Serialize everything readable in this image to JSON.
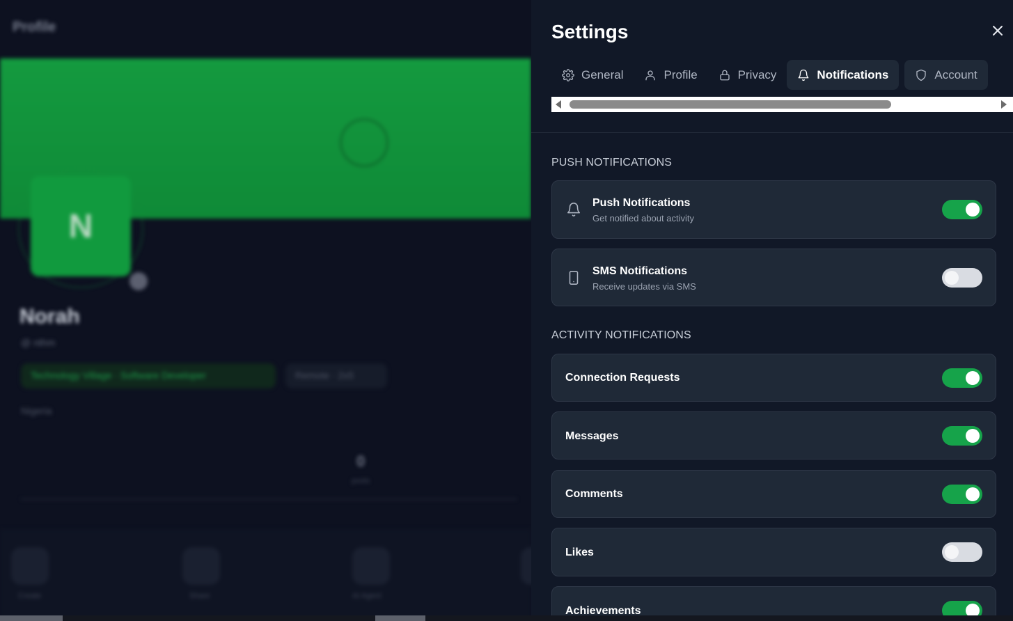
{
  "background": {
    "page_title": "Profile",
    "avatar_initial": "N",
    "name": "Norah",
    "handle": "@ nthm",
    "role_chip": "Technology Village · Software Developer",
    "status_chip": "Remote · 2x5",
    "location": "Nigeria",
    "stat_value": "0",
    "stat_label": "posts",
    "actions": [
      {
        "label": "Create"
      },
      {
        "label": "Share"
      },
      {
        "label": "AI Agent"
      }
    ]
  },
  "settings": {
    "title": "Settings",
    "close_icon": "close-icon",
    "tabs": [
      {
        "label": "General",
        "icon": "gear-icon",
        "active": false
      },
      {
        "label": "Profile",
        "icon": "user-icon",
        "active": false
      },
      {
        "label": "Privacy",
        "icon": "lock-icon",
        "active": false
      },
      {
        "label": "Notifications",
        "icon": "bell-icon",
        "active": true
      },
      {
        "label": "Account",
        "icon": "shield-icon",
        "active": false
      }
    ],
    "sections": {
      "push": {
        "title": "PUSH NOTIFICATIONS",
        "items": [
          {
            "label": "Push Notifications",
            "description": "Get notified about activity",
            "icon": "bell-icon",
            "enabled": true
          },
          {
            "label": "SMS Notifications",
            "description": "Receive updates via SMS",
            "icon": "phone-icon",
            "enabled": false
          }
        ]
      },
      "activity": {
        "title": "ACTIVITY NOTIFICATIONS",
        "items": [
          {
            "label": "Connection Requests",
            "enabled": true
          },
          {
            "label": "Messages",
            "enabled": true
          },
          {
            "label": "Comments",
            "enabled": true
          },
          {
            "label": "Likes",
            "enabled": false
          },
          {
            "label": "Achievements",
            "enabled": true
          }
        ]
      }
    }
  },
  "colors": {
    "accent_green": "#16a34a",
    "panel_bg": "#111827",
    "card_bg": "#1f2937"
  }
}
